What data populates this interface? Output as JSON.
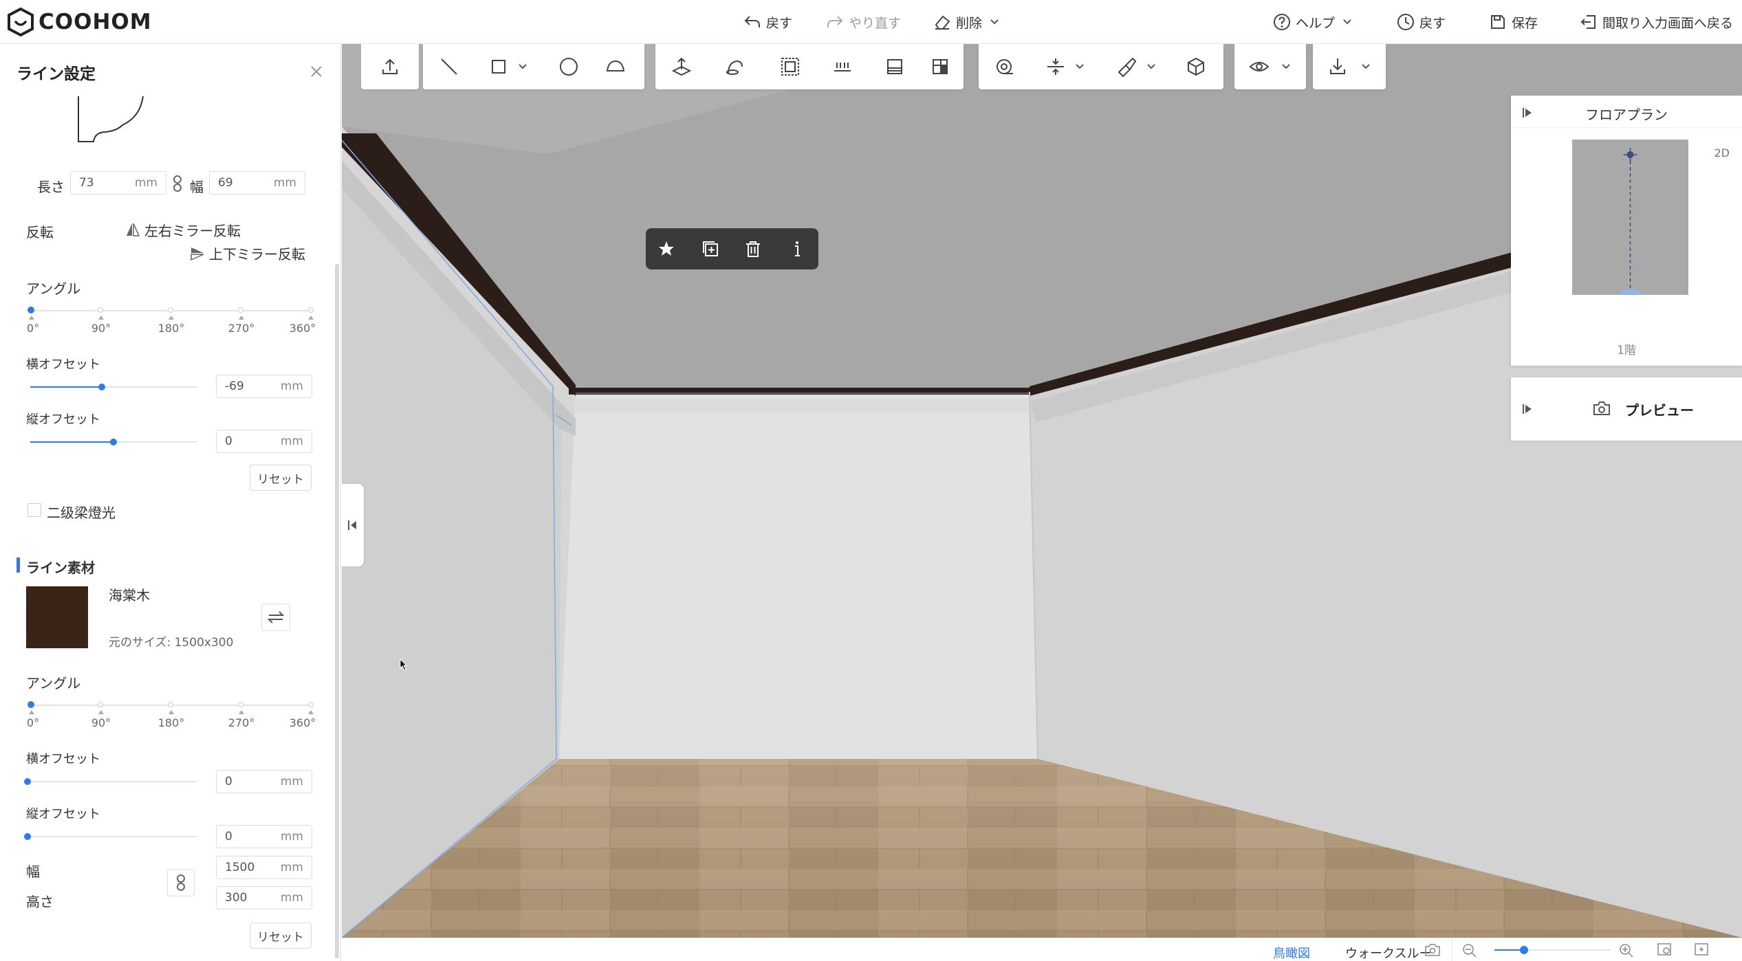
{
  "app": {
    "logo_text": "COOHOM"
  },
  "topbar": {
    "undo": "戻す",
    "redo": "やり直す",
    "delete": "削除",
    "help": "ヘルプ",
    "history": "戻す",
    "save": "保存",
    "back_to_floorplan": "間取り入力画面へ戻る"
  },
  "left_panel": {
    "title": "ライン設定",
    "size": {
      "length_label": "長さ",
      "length_value": "73",
      "width_label": "幅",
      "width_value": "69",
      "unit": "mm"
    },
    "flip": {
      "label": "反転",
      "horizontal": "左右ミラー反転",
      "vertical": "上下ミラー反転"
    },
    "angle1": {
      "label": "アングル",
      "ticks": [
        "0°",
        "90°",
        "180°",
        "270°",
        "360°"
      ],
      "value": 0
    },
    "h_offset1": {
      "label": "横オフセット",
      "value": "-69",
      "unit": "mm",
      "slider_fraction": 0.43
    },
    "v_offset1": {
      "label": "縦オフセット",
      "value": "0",
      "unit": "mm",
      "slider_fraction": 0.5
    },
    "reset1": "リセット",
    "checkbox_label": "二级梁燈光",
    "material": {
      "section_title": "ライン素材",
      "name": "海棠木",
      "original_size": "元のサイズ: 1500x300",
      "swatch_color": "#3a2418"
    },
    "angle2": {
      "label": "アングル",
      "ticks": [
        "0°",
        "90°",
        "180°",
        "270°",
        "360°"
      ],
      "value": 0
    },
    "h_offset2": {
      "label": "横オフセット",
      "value": "0",
      "unit": "mm",
      "slider_fraction": 0
    },
    "v_offset2": {
      "label": "縦オフセット",
      "value": "0",
      "unit": "mm",
      "slider_fraction": 0
    },
    "tex_width": {
      "label": "幅",
      "value": "1500",
      "unit": "mm"
    },
    "tex_height": {
      "label": "高さ",
      "value": "300",
      "unit": "mm"
    },
    "reset2": "リセット"
  },
  "floorplan": {
    "title": "フロアプラン",
    "mode": "2D",
    "floor": "1階"
  },
  "preview": {
    "title": "プレビュー"
  },
  "bottombar": {
    "tab_birdseye": "鳥瞰図",
    "tab_walkthrough": "ウォークスルー"
  },
  "colors": {
    "accent": "#2f7ae5",
    "ceiling_molding": "#2b1d17"
  }
}
